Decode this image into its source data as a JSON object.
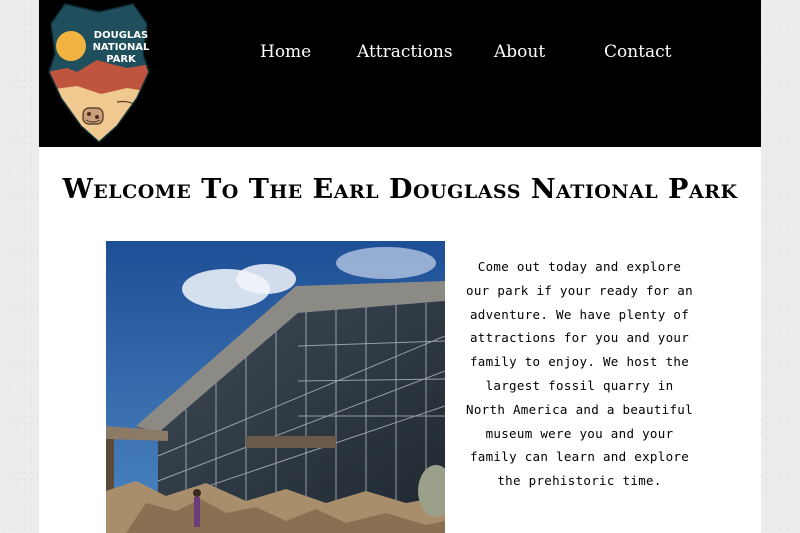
{
  "logo": {
    "text_line1": "DOUGLAS",
    "text_line2": "NATIONAL",
    "text_line3": "PARK",
    "icon": "arrowhead-park-logo"
  },
  "nav": {
    "items": [
      {
        "label": "Home"
      },
      {
        "label": "Attractions"
      },
      {
        "label": "About"
      },
      {
        "label": "Contact"
      }
    ]
  },
  "main": {
    "title": "Welcome To The Earl Douglass National Park",
    "intro": "Come out today and explore our park if your ready for an adventure. We have plenty of attractions for you and your family to enjoy. We host the largest fossil quarry in North America and a beautiful museum were you and your family can learn and explore the prehistoric time."
  },
  "colors": {
    "header_bg": "#000000",
    "page_bg": "#ffffff",
    "body_bg": "#ececea",
    "logo_teal": "#1f4f5c",
    "logo_sun": "#f2b441",
    "logo_red": "#c0553d",
    "logo_sand": "#efc98f"
  }
}
